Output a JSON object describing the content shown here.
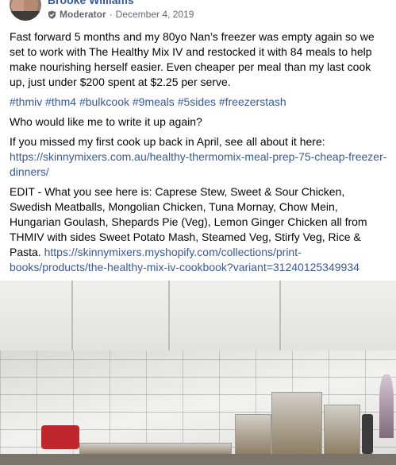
{
  "post": {
    "author": "Brooke Williams",
    "role": "Moderator",
    "separator": "·",
    "date": "December 4, 2019",
    "paragraph1": "Fast forward 5 months and my 80yo Nan’s freezer was empty again so we set to work with The Healthy Mix IV and restocked it with 84 meals to help make nourishing herself easier. Even cheaper per meal than my last cook up, just under $200 spent at $2.25 per serve.",
    "hashtags": [
      "#thmiv",
      "#thm4",
      "#bulkcook",
      "#9meals",
      "#5sides",
      "#freezerstash"
    ],
    "question": "Who would like me to write it up again?",
    "missed_text": "If you missed my first cook up back in April, see all about it here:",
    "missed_link": "https://skinnymixers.com.au/healthy-thermomix-meal-prep-75-cheap-freezer-dinners/",
    "edit_text": "EDIT - What you see here is: Caprese Stew, Sweet & Sour Chicken, Swedish Meatballs, Mongolian Chicken, Tuna Mornay, Chow Mein, Hungarian Goulash, Shepards Pie (Veg), Lemon Ginger Chicken all from THMIV with sides Sweet Potato Mash, Steamed Veg, Stirfy Veg, Rice & Pasta.",
    "edit_link": "https://skinnymixers.myshopify.com/collections/print-books/products/the-healthy-mix-iv-cookbook?variant=31240125349934"
  },
  "icons": {
    "moderator_badge": "shield-check-icon"
  },
  "colors": {
    "link": "#385898",
    "meta": "#65676b",
    "text": "#050505"
  }
}
